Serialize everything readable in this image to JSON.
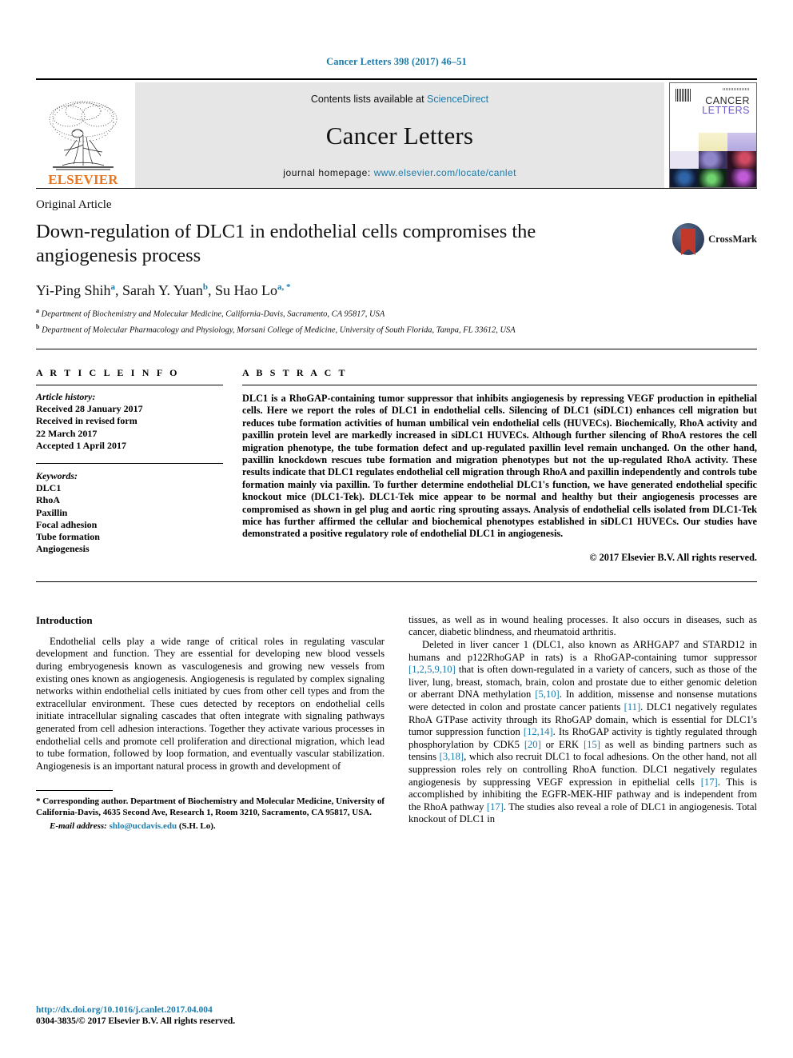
{
  "running_head": "Cancer Letters 398 (2017) 46–51",
  "masthead": {
    "publisher": "ELSEVIER",
    "contents_prefix": "Contents lists available at ",
    "contents_link": "ScienceDirect",
    "journal_name": "Cancer Letters",
    "homepage_label": "journal homepage: ",
    "homepage_url": "www.elsevier.com/locate/canlet",
    "cover_title_line1": "CANCER",
    "cover_title_line2": "LETTERS"
  },
  "article": {
    "type": "Original Article",
    "title": "Down-regulation of DLC1 in endothelial cells compromises the angiogenesis process",
    "crossmark_label": "CrossMark",
    "authors": [
      {
        "name": "Yi-Ping Shih",
        "sup": "a"
      },
      {
        "name": "Sarah Y. Yuan",
        "sup": "b"
      },
      {
        "name": "Su Hao Lo",
        "sup": "a, *"
      }
    ],
    "authors_line": "Yi-Ping Shih a, Sarah Y. Yuan b, Su Hao Lo a, *",
    "affiliations": [
      {
        "marker": "a",
        "text": "Department of Biochemistry and Molecular Medicine, California-Davis, Sacramento, CA 95817, USA"
      },
      {
        "marker": "b",
        "text": "Department of Molecular Pharmacology and Physiology, Morsani College of Medicine, University of South Florida, Tampa, FL 33612, USA"
      }
    ]
  },
  "article_info": {
    "heading": "A R T I C L E   I N F O",
    "history_label": "Article history:",
    "history": [
      "Received 28 January 2017",
      "Received in revised form",
      "22 March 2017",
      "Accepted 1 April 2017"
    ],
    "keywords_label": "Keywords:",
    "keywords": [
      "DLC1",
      "RhoA",
      "Paxillin",
      "Focal adhesion",
      "Tube formation",
      "Angiogenesis"
    ]
  },
  "abstract": {
    "heading": "A B S T R A C T",
    "text": "DLC1 is a RhoGAP-containing tumor suppressor that inhibits angiogenesis by repressing VEGF production in epithelial cells. Here we report the roles of DLC1 in endothelial cells. Silencing of DLC1 (siDLC1) enhances cell migration but reduces tube formation activities of human umbilical vein endothelial cells (HUVECs). Biochemically, RhoA activity and paxillin protein level are markedly increased in siDLC1 HUVECs. Although further silencing of RhoA restores the cell migration phenotype, the tube formation defect and up-regulated paxillin level remain unchanged. On the other hand, paxillin knockdown rescues tube formation and migration phenotypes but not the up-regulated RhoA activity. These results indicate that DLC1 regulates endothelial cell migration through RhoA and paxillin independently and controls tube formation mainly via paxillin. To further determine endothelial DLC1's function, we have generated endothelial specific knockout mice (DLC1-Tek). DLC1-Tek mice appear to be normal and healthy but their angiogenesis processes are compromised as shown in gel plug and aortic ring sprouting assays. Analysis of endothelial cells isolated from DLC1-Tek mice has further affirmed the cellular and biochemical phenotypes established in siDLC1 HUVECs. Our studies have demonstrated a positive regulatory role of endothelial DLC1 in angiogenesis.",
    "copyright": "© 2017 Elsevier B.V. All rights reserved."
  },
  "body": {
    "section_title": "Introduction",
    "left_paragraphs": [
      "Endothelial cells play a wide range of critical roles in regulating vascular development and function. They are essential for developing new blood vessels during embryogenesis known as vasculogenesis and growing new vessels from existing ones known as angiogenesis. Angiogenesis is regulated by complex signaling networks within endothelial cells initiated by cues from other cell types and from the extracellular environment. These cues detected by receptors on endothelial cells initiate intracellular signaling cascades that often integrate with signaling pathways generated from cell adhesion interactions. Together they activate various processes in endothelial cells and promote cell proliferation and directional migration, which lead to tube formation, followed by loop formation, and eventually vascular stabilization. Angiogenesis is an important natural process in growth and development of"
    ],
    "right_paragraph_1": "tissues, as well as in wound healing processes. It also occurs in diseases, such as cancer, diabetic blindness, and rheumatoid arthritis.",
    "right_paragraph_2_parts": [
      {
        "t": "Deleted in liver cancer 1 (DLC1, also known as ARHGAP7 and STARD12 in humans and p122RhoGAP in rats) is a RhoGAP-containing tumor suppressor ",
        "cite": false
      },
      {
        "t": "[1,2,5,9,10]",
        "cite": true
      },
      {
        "t": " that is often down-regulated in a variety of cancers, such as those of the liver, lung, breast, stomach, brain, colon and prostate due to either genomic deletion or aberrant DNA methylation ",
        "cite": false
      },
      {
        "t": "[5,10]",
        "cite": true
      },
      {
        "t": ". In addition, missense and nonsense mutations were detected in colon and prostate cancer patients ",
        "cite": false
      },
      {
        "t": "[11]",
        "cite": true
      },
      {
        "t": ". DLC1 negatively regulates RhoA GTPase activity through its RhoGAP domain, which is essential for DLC1's tumor suppression function ",
        "cite": false
      },
      {
        "t": "[12,14]",
        "cite": true
      },
      {
        "t": ". Its RhoGAP activity is tightly regulated through phosphorylation by CDK5 ",
        "cite": false
      },
      {
        "t": "[20]",
        "cite": true
      },
      {
        "t": " or ERK ",
        "cite": false
      },
      {
        "t": "[15]",
        "cite": true
      },
      {
        "t": " as well as binding partners such as tensins ",
        "cite": false
      },
      {
        "t": "[3,18]",
        "cite": true
      },
      {
        "t": ", which also recruit DLC1 to focal adhesions. On the other hand, not all suppression roles rely on controlling RhoA function. DLC1 negatively regulates angiogenesis by suppressing VEGF expression in epithelial cells ",
        "cite": false
      },
      {
        "t": "[17]",
        "cite": true
      },
      {
        "t": ". This is accomplished by inhibiting the EGFR-MEK-HIF pathway and is independent from the RhoA pathway ",
        "cite": false
      },
      {
        "t": "[17]",
        "cite": true
      },
      {
        "t": ". The studies also reveal a role of DLC1 in angiogenesis. Total knockout of DLC1 in",
        "cite": false
      }
    ]
  },
  "footnote": {
    "star": "*",
    "text": " Corresponding author. Department of Biochemistry and Molecular Medicine, University of California-Davis, 4635 Second Ave, Research 1, Room 3210, Sacramento, CA 95817, USA.",
    "email_label": "E-mail address: ",
    "email": "shlo@ucdavis.edu",
    "email_suffix": " (S.H. Lo)."
  },
  "footer": {
    "doi": "http://dx.doi.org/10.1016/j.canlet.2017.04.004",
    "issn": "0304-3835/© 2017 Elsevier B.V. All rights reserved."
  },
  "colors": {
    "link": "#1a7bab",
    "elsevier_orange": "#E87722",
    "band_gray": "#e6e6e6"
  }
}
